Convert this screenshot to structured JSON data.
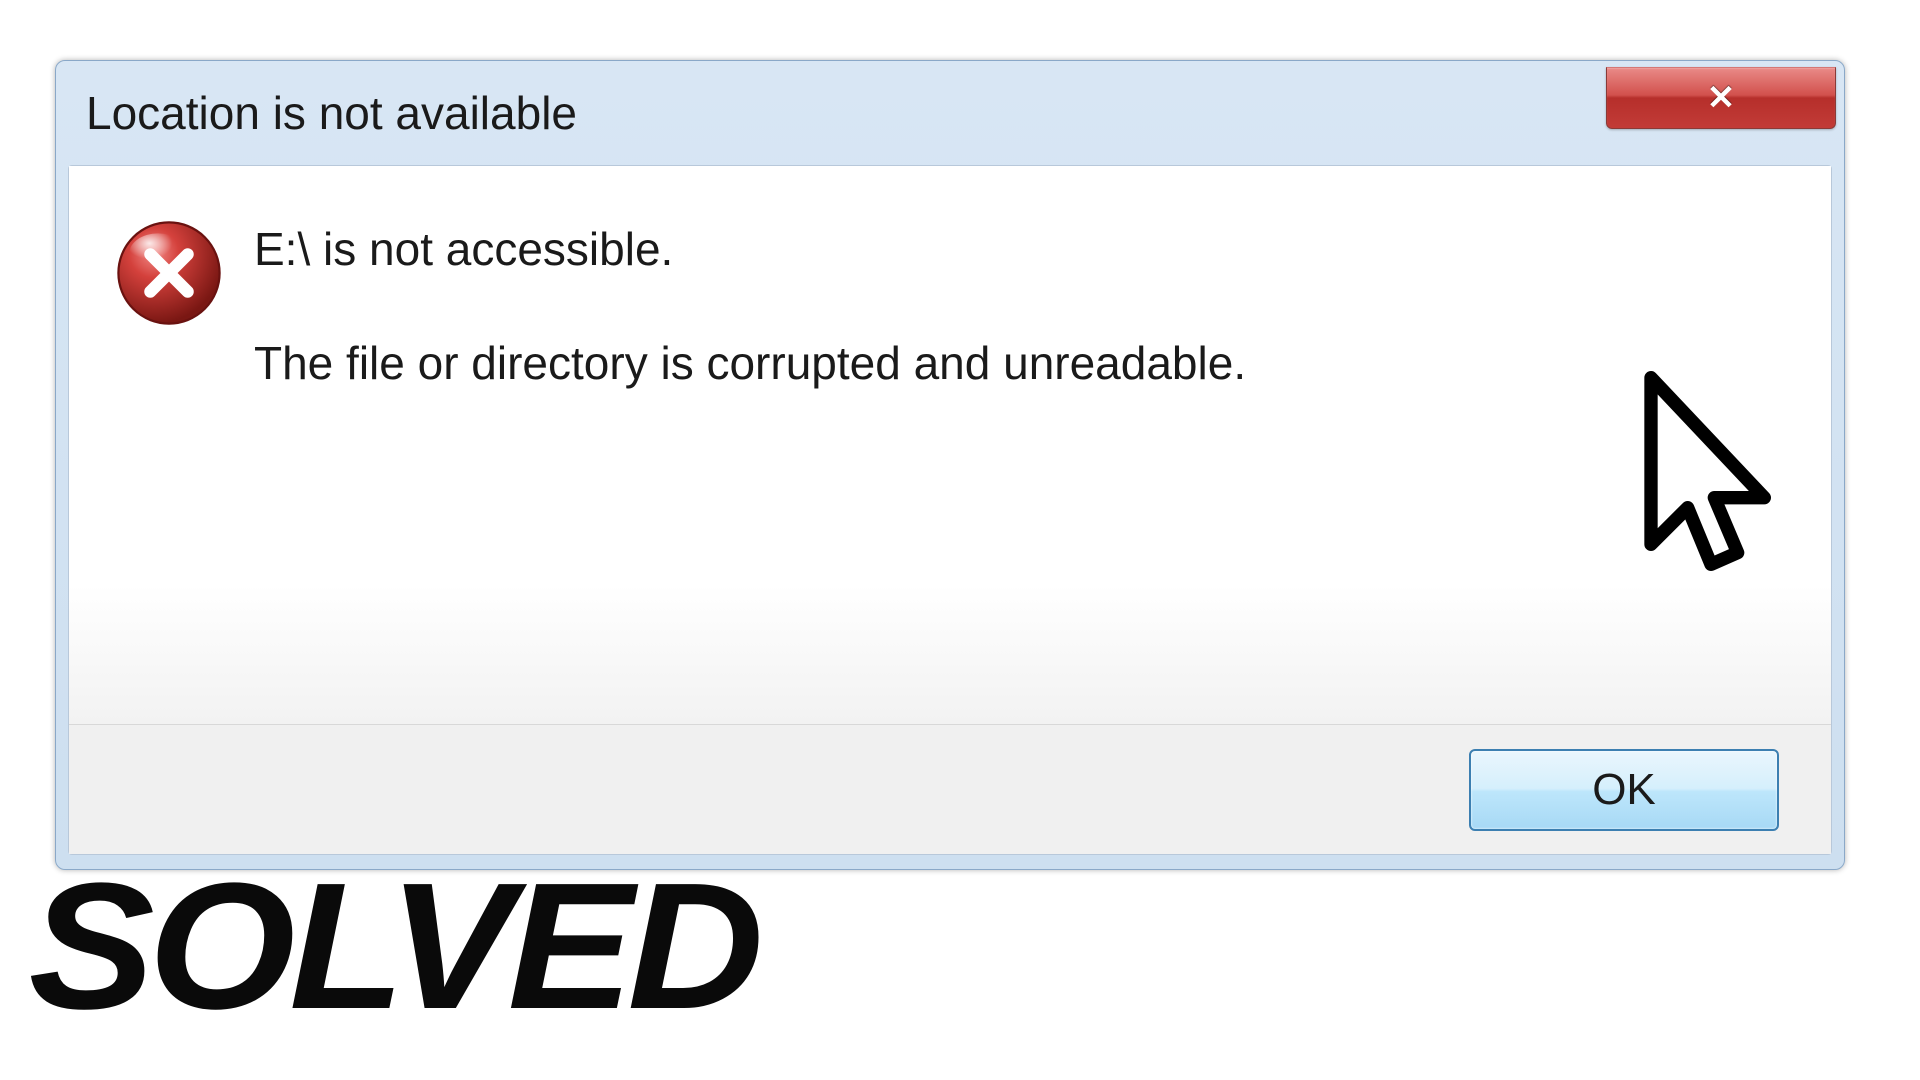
{
  "dialog": {
    "title": "Location is not available",
    "close_glyph": "✕",
    "message_line1": "E:\\ is not accessible.",
    "message_line2": "The file or directory is corrupted and unreadable.",
    "ok_label": "OK"
  },
  "overlay": {
    "solved_text": "SOLVED"
  }
}
